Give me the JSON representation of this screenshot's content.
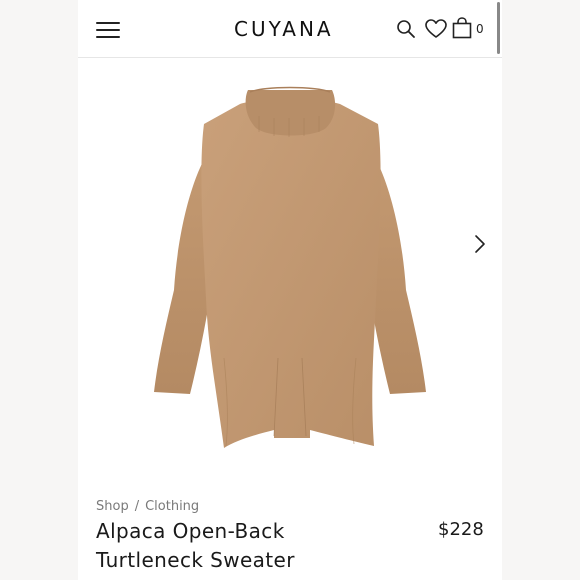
{
  "header": {
    "brand": "CUYANA",
    "cart_count": "0",
    "icons": [
      "menu-icon",
      "search-icon",
      "heart-icon",
      "shopping-bag-icon"
    ]
  },
  "breadcrumb": {
    "items": [
      "Shop",
      "Clothing"
    ],
    "separator": "/"
  },
  "product": {
    "title_line1": "Alpaca Open-Back",
    "title_line2": "Turtleneck Sweater",
    "price": "$228",
    "color_hex": "#c49a72"
  },
  "carousel": {
    "next_icon": "chevron-right-icon"
  }
}
